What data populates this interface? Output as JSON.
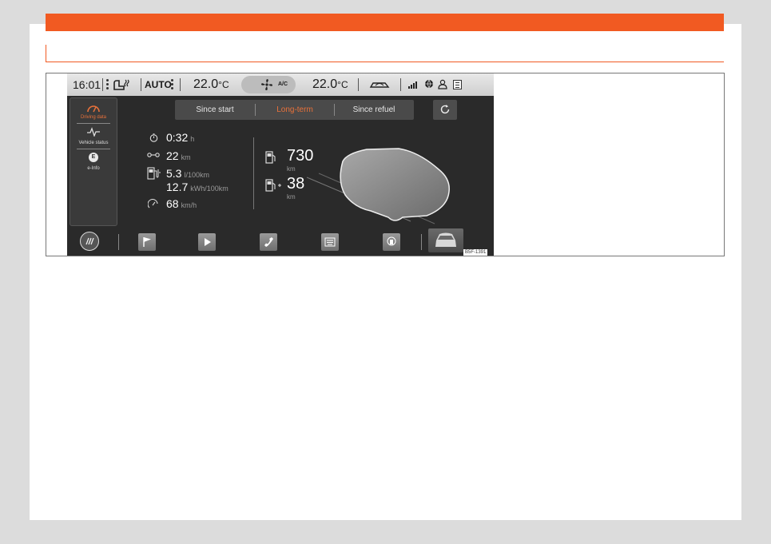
{
  "status_bar": {
    "time": "16:01",
    "climate_mode": "AUTO",
    "temp_left": "22.0",
    "temp_right": "22.0",
    "temp_unit": "°C",
    "ac_label": "A/C"
  },
  "side_menu": {
    "items": [
      {
        "label": "Driving data",
        "active": true
      },
      {
        "label": "Vehicle status",
        "active": false
      },
      {
        "label": "e-Info",
        "active": false
      }
    ],
    "e_badge": "E"
  },
  "tabs": [
    {
      "label": "Since start",
      "active": false
    },
    {
      "label": "Long-term",
      "active": true
    },
    {
      "label": "Since refuel",
      "active": false
    }
  ],
  "trip": {
    "duration": {
      "value": "0:32",
      "unit": "h"
    },
    "distance": {
      "value": "22",
      "unit": "km"
    },
    "fuel_consumption": {
      "value": "5.3",
      "unit": "l/100km"
    },
    "electric_consumption": {
      "value": "12.7",
      "unit": "kWh/100km"
    },
    "avg_speed": {
      "value": "68",
      "unit": "km/h"
    }
  },
  "range": {
    "fuel": {
      "value": "730",
      "unit": "km"
    },
    "electric": {
      "value": "38",
      "unit": "km"
    }
  },
  "figure_code": "B5F-1391",
  "colors": {
    "accent": "#f15a22",
    "active_text": "#e8713a",
    "screen_bg": "#2a2a2a"
  }
}
